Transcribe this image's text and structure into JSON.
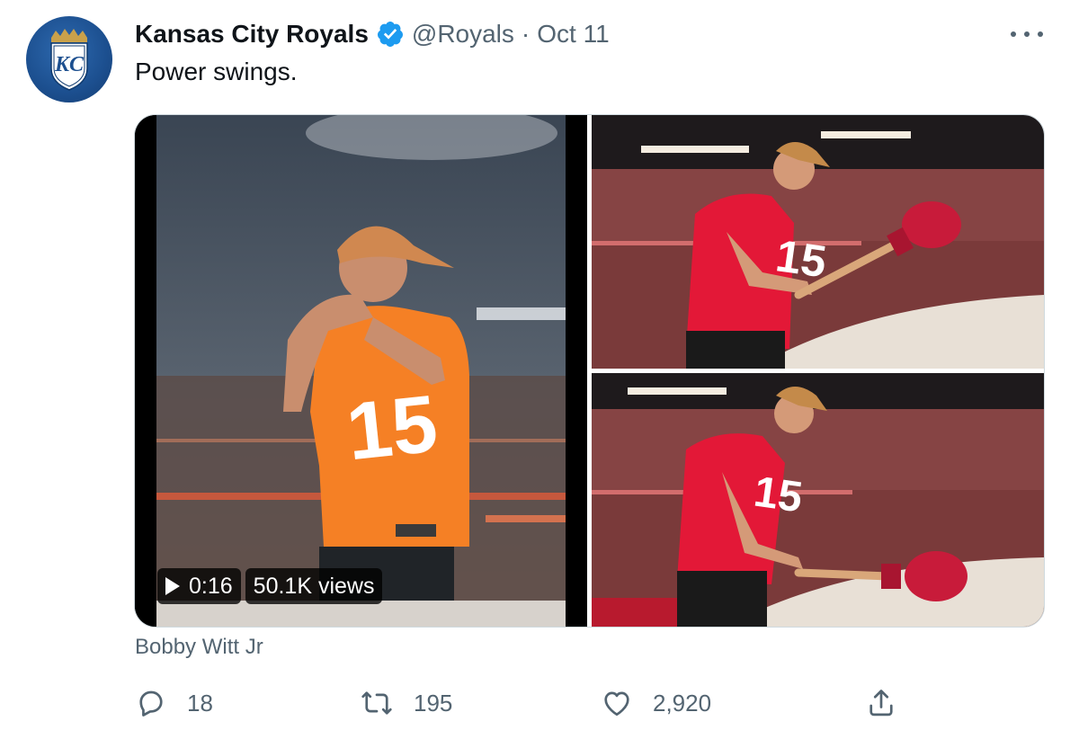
{
  "author": {
    "name": "Kansas City Royals",
    "handle": "@Royals",
    "separator": "·",
    "date": "Oct 11",
    "verified_icon": "verified-badge-icon",
    "avatar_monogram": "KC",
    "colors": {
      "verified": "#1d9bf0",
      "avatar_blue": "#1c4f8f",
      "crown_gold": "#c9a14a"
    }
  },
  "tweet": {
    "text": "Power swings."
  },
  "media": {
    "video": {
      "duration": "0:16",
      "views": "50.1K views"
    },
    "photos": 2
  },
  "caption": "Bobby Witt Jr",
  "actions": {
    "reply": {
      "icon": "reply-icon",
      "count": "18"
    },
    "retweet": {
      "icon": "retweet-icon",
      "count": "195"
    },
    "like": {
      "icon": "heart-icon",
      "count": "2,920"
    },
    "share": {
      "icon": "share-icon"
    }
  },
  "colors": {
    "text_primary": "#0f1419",
    "text_secondary": "#536471",
    "chiefs_red": "#e31837",
    "chiefs_gold": "#ffb81c"
  }
}
